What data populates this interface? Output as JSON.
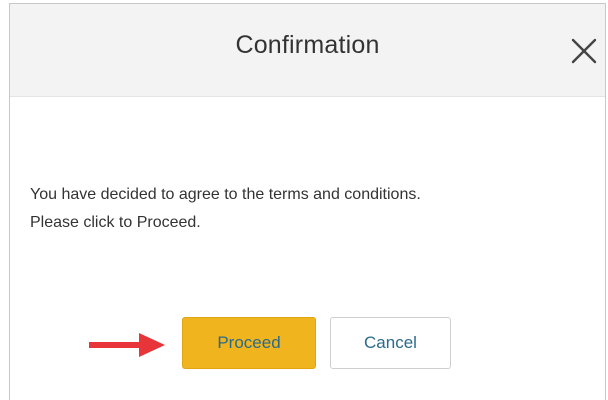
{
  "dialog": {
    "title": "Confirmation",
    "message_line1": "You have decided to agree to the terms and conditions.",
    "message_line2": "Please click to Proceed.",
    "close_icon": "close-icon",
    "buttons": {
      "proceed_label": "Proceed",
      "cancel_label": "Cancel"
    },
    "annotation_icon": "arrow-right-icon"
  },
  "colors": {
    "proceed_bg": "#f0b41f",
    "button_text": "#2a6b8a",
    "arrow": "#e8353a",
    "header_bg": "#f3f3f3"
  }
}
